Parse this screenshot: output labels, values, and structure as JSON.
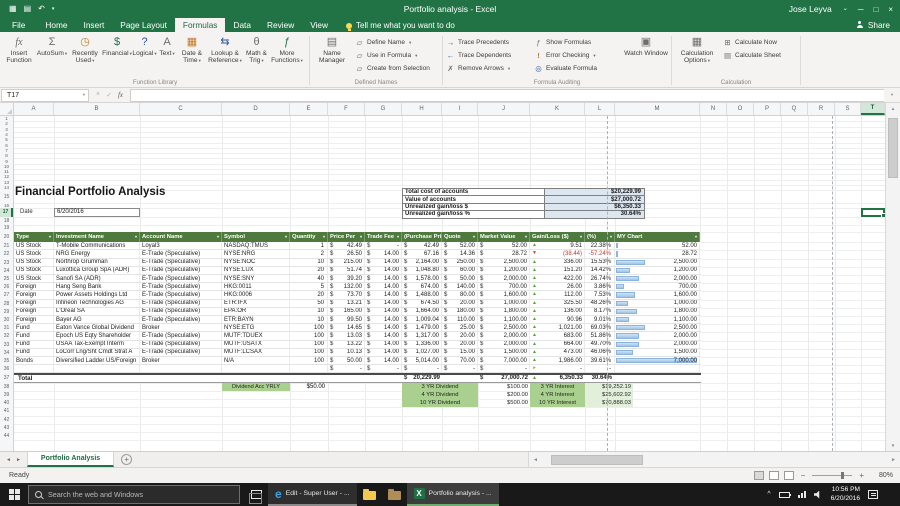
{
  "colors": {
    "excel_green": "#217346",
    "table_header_green": "#4e7a3e",
    "summary_value_blue": "#dce6f1",
    "label_cell_green": "#a9d08e",
    "interest_cell_green": "#e2efda",
    "gain_up": "#4ea72e",
    "gain_down": "#d03b2f"
  },
  "titlebar": {
    "title": "Portfolio analysis - Excel",
    "user": "Jose Leyva"
  },
  "ribbon": {
    "tabs": [
      "File",
      "Home",
      "Insert",
      "Page Layout",
      "Formulas",
      "Data",
      "Review",
      "View"
    ],
    "active_tab": "Formulas",
    "tell_me": "Tell me what you want to do",
    "share": "Share",
    "function_library": {
      "label": "Function Library",
      "insert_function": "Insert Function",
      "autosum": "AutoSum",
      "recently_used": "Recently Used",
      "financial": "Financial",
      "logical": "Logical",
      "text": "Text",
      "date_time": "Date & Time",
      "lookup_reference": "Lookup & Reference",
      "math_trig": "Math & Trig",
      "more_functions": "More Functions"
    },
    "defined_names": {
      "label": "Defined Names",
      "name_manager": "Name Manager",
      "define_name": "Define Name",
      "use_in_formula": "Use in Formula",
      "create_from_selection": "Create from Selection"
    },
    "formula_auditing": {
      "label": "Formula Auditing",
      "trace_precedents": "Trace Precedents",
      "trace_dependents": "Trace Dependents",
      "remove_arrows": "Remove Arrows",
      "show_formulas": "Show Formulas",
      "error_checking": "Error Checking",
      "evaluate_formula": "Evaluate Formula",
      "watch_window": "Watch Window"
    },
    "calculation": {
      "label": "Calculation",
      "calculation_options": "Calculation Options",
      "calculate_now": "Calculate Now",
      "calculate_sheet": "Calculate Sheet"
    }
  },
  "formula_bar": {
    "name_box": "T17",
    "formula": ""
  },
  "sheet": {
    "columns": [
      "A",
      "B",
      "C",
      "D",
      "E",
      "F",
      "G",
      "H",
      "I",
      "J",
      "K",
      "L",
      "M",
      "N",
      "O",
      "P",
      "Q",
      "R",
      "S",
      "T"
    ],
    "active_cell": "T17",
    "title": "Financial Portfolio Analysis",
    "date_label": "Date",
    "date_value": "6/20/2016",
    "summary": [
      {
        "label": "Total cost of accounts",
        "value": "$20,229.99"
      },
      {
        "label": "Value of accounts",
        "value": "$27,000.72"
      },
      {
        "label": "Unrealized gain/loss $",
        "value": "$6,350.33"
      },
      {
        "label": "Unrealized gain/loss %",
        "value": "30.64%"
      }
    ],
    "table": {
      "headers": [
        "Type",
        "Investment Name",
        "Account Name",
        "Symbol",
        "Quantity",
        "Price Per",
        "Trade Fee",
        "(Purchase Price)",
        "Quote",
        "Market Value",
        "Gain/Loss ($)",
        "(%)",
        "MY Chart"
      ],
      "rows": [
        {
          "type": "US Stock",
          "name": "T-Mobile Communications",
          "account": "Loyal3",
          "symbol": "NASDAQ:TMUS",
          "qty": "1",
          "price": "42.49",
          "fee": "-",
          "purchase": "42.49",
          "quote": "52.00",
          "market": "52.00",
          "gain": "9.51",
          "pct": "22.38%",
          "chart": "52.00",
          "dir": "up"
        },
        {
          "type": "US Stock",
          "name": "NRG Energy",
          "account": "E-Trade (Speculative)",
          "symbol": "NYSE:NRG",
          "qty": "2",
          "price": "26.50",
          "fee": "14.00",
          "purchase": "67.16",
          "quote": "14.36",
          "market": "28.72",
          "gain": "(38.44)",
          "pct": "-57.24%",
          "chart": "28.72",
          "dir": "down",
          "neg": true
        },
        {
          "type": "US Stock",
          "name": "Northrop Grumman",
          "account": "E-Trade (Speculative)",
          "symbol": "NYSE:NOC",
          "qty": "10",
          "price": "215.00",
          "fee": "14.00",
          "purchase": "2,164.00",
          "quote": "250.00",
          "market": "2,500.00",
          "gain": "336.00",
          "pct": "15.53%",
          "chart": "2,500.00",
          "dir": "up"
        },
        {
          "type": "US Stock",
          "name": "Luxottica Group SpA (ADR)",
          "account": "E-Trade (Speculative)",
          "symbol": "NYSE:LUX",
          "qty": "20",
          "price": "51.74",
          "fee": "14.00",
          "purchase": "1,048.80",
          "quote": "60.00",
          "market": "1,200.00",
          "gain": "151.20",
          "pct": "14.42%",
          "chart": "1,200.00",
          "dir": "up"
        },
        {
          "type": "US Stock",
          "name": "Sanofi SA (ADR)",
          "account": "E-Trade (Speculative)",
          "symbol": "NYSE:SNY",
          "qty": "40",
          "price": "39.20",
          "fee": "14.00",
          "purchase": "1,578.00",
          "quote": "50.00",
          "market": "2,000.00",
          "gain": "422.00",
          "pct": "26.74%",
          "chart": "2,000.00",
          "dir": "up"
        },
        {
          "type": "Foreign",
          "name": "Hang Seng Bank",
          "account": "E-Trade (Speculative)",
          "symbol": "HKG:0011",
          "qty": "5",
          "price": "132.00",
          "fee": "14.00",
          "purchase": "674.00",
          "quote": "140.00",
          "market": "700.00",
          "gain": "26.00",
          "pct": "3.86%",
          "chart": "700.00",
          "dir": "up"
        },
        {
          "type": "Foreign",
          "name": "Power Assets Holdings Ltd",
          "account": "E-Trade (Speculative)",
          "symbol": "HKG:0006",
          "qty": "20",
          "price": "73.70",
          "fee": "14.00",
          "purchase": "1,488.00",
          "quote": "80.00",
          "market": "1,600.00",
          "gain": "112.00",
          "pct": "7.53%",
          "chart": "1,600.00",
          "dir": "up"
        },
        {
          "type": "Foreign",
          "name": "Infineon Technologies AG",
          "account": "E-Trade (Speculative)",
          "symbol": "ETR:IFX",
          "qty": "50",
          "price": "13.21",
          "fee": "14.00",
          "purchase": "674.50",
          "quote": "20.00",
          "market": "1,000.00",
          "gain": "325.50",
          "pct": "48.26%",
          "chart": "1,000.00",
          "dir": "up"
        },
        {
          "type": "Foreign",
          "name": "L'Oreal SA",
          "account": "E-Trade (Speculative)",
          "symbol": "EPA:OR",
          "qty": "10",
          "price": "165.00",
          "fee": "14.00",
          "purchase": "1,664.00",
          "quote": "180.00",
          "market": "1,800.00",
          "gain": "136.00",
          "pct": "8.17%",
          "chart": "1,800.00",
          "dir": "up"
        },
        {
          "type": "Foreign",
          "name": "Bayer AG",
          "account": "E-Trade (Speculative)",
          "symbol": "ETR:BAYN",
          "qty": "10",
          "price": "99.50",
          "fee": "14.00",
          "purchase": "1,009.04",
          "quote": "110.00",
          "market": "1,100.00",
          "gain": "90.96",
          "pct": "9.01%",
          "chart": "1,100.00",
          "dir": "up"
        },
        {
          "type": "Fund",
          "name": "Eaton Vance Global Dividend",
          "account": "Broker",
          "symbol": "NYSE:ETG",
          "qty": "100",
          "price": "14.65",
          "fee": "14.00",
          "purchase": "1,479.00",
          "quote": "25.00",
          "market": "2,500.00",
          "gain": "1,021.00",
          "pct": "69.03%",
          "chart": "2,500.00",
          "dir": "up"
        },
        {
          "type": "Fund",
          "name": "Epoch US Eqty Shareholder",
          "account": "E-Trade (Speculative)",
          "symbol": "MUTF:TDUEX",
          "qty": "100",
          "price": "13.03",
          "fee": "14.00",
          "purchase": "1,317.00",
          "quote": "20.00",
          "market": "2,000.00",
          "gain": "683.00",
          "pct": "51.86%",
          "chart": "2,000.00",
          "dir": "up"
        },
        {
          "type": "Fund",
          "name": "USAA Tax-Exempt Interm",
          "account": "E-Trade (Speculative)",
          "symbol": "MUTF:USATX",
          "qty": "100",
          "price": "13.22",
          "fee": "14.00",
          "purchase": "1,336.00",
          "quote": "20.00",
          "market": "2,000.00",
          "gain": "664.00",
          "pct": "49.70%",
          "chart": "2,000.00",
          "dir": "up"
        },
        {
          "type": "Fund",
          "name": "LoCorr Lng/Sht Cmdt Strat A",
          "account": "E-Trade (Speculative)",
          "symbol": "MUTF:LCSAX",
          "qty": "100",
          "price": "10.13",
          "fee": "14.00",
          "purchase": "1,027.00",
          "quote": "15.00",
          "market": "1,500.00",
          "gain": "473.00",
          "pct": "46.06%",
          "chart": "1,500.00",
          "dir": "up"
        },
        {
          "type": "Bonds",
          "name": "Diversified Ladder US/Foreign",
          "account": "Broker",
          "symbol": "N/A",
          "qty": "100",
          "price": "50.00",
          "fee": "14.00",
          "purchase": "5,014.00",
          "quote": "70.00",
          "market": "7,000.00",
          "gain": "1,986.00",
          "pct": "39.61%",
          "chart": "7,000.00",
          "dir": "up"
        }
      ],
      "empty_row": {
        "type": "",
        "name": "",
        "account": "",
        "symbol": "",
        "qty": "",
        "price": "-",
        "fee": "-",
        "purchase": "-",
        "quote": "-",
        "market": "-",
        "gain": "-",
        "pct": "-",
        "chart": "",
        "dir": "flat"
      },
      "total": {
        "label": "Total",
        "purchase": "20,229.99",
        "market": "27,000.72",
        "gain": "6,350.33",
        "pct": "30.64%"
      }
    },
    "extras": {
      "dividend_acc_label": "Dividend Acc YRLY",
      "dividend_acc_value": "$50.00",
      "projections": [
        {
          "div_label": "3 YR Dividend",
          "div_value": "$100.00",
          "int_label": "3 YR Interest",
          "int_value": "$19,252.19"
        },
        {
          "div_label": "4 YR Dividend",
          "div_value": "$200.00",
          "int_label": "4 YR Interest",
          "int_value": "$25,602.92"
        },
        {
          "div_label": "10 YR Dividend",
          "div_value": "$500.00",
          "int_label": "10 YR Interest",
          "int_value": "$70,888.03"
        }
      ]
    },
    "sheet_tab": "Portfolio Analysis"
  },
  "status_bar": {
    "mode": "Ready",
    "zoom": "80%"
  },
  "taskbar": {
    "search_placeholder": "Search the web and Windows",
    "apps": [
      {
        "name": "edge",
        "label": "Edit - Super User - ..."
      },
      {
        "name": "file-explorer",
        "label": ""
      },
      {
        "name": "folder",
        "label": ""
      },
      {
        "name": "excel",
        "label": "Portfolio analysis - ..."
      }
    ],
    "clock_time": "10:56 PM",
    "clock_date": "6/20/2016"
  }
}
